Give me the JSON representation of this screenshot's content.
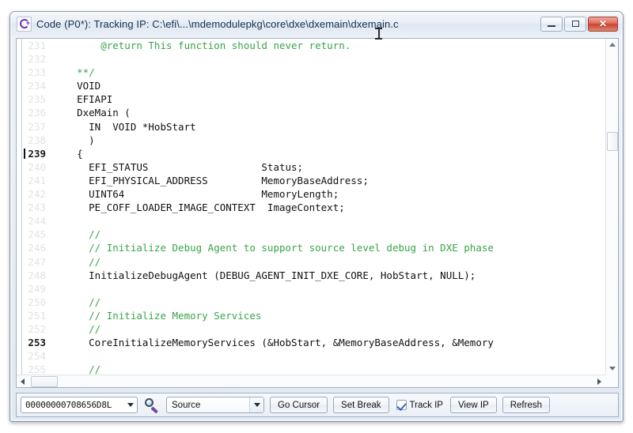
{
  "window": {
    "icon_name": "code-debugger-icon",
    "title": "Code (P0*): Tracking IP: C:\\efi\\...\\mdemodulepkg\\core\\dxe\\dxemain\\dxemain.c",
    "controls": {
      "minimize": "minimize-icon",
      "maximize": "maximize-icon",
      "close": "✕"
    }
  },
  "editor": {
    "current_line": "239",
    "breakpoint_line": "253",
    "lines": [
      {
        "num": "231",
        "text": "        @return This function should never return.",
        "style": "comment",
        "active": false,
        "caret": false
      },
      {
        "num": "232",
        "text": "",
        "style": "code",
        "active": false,
        "caret": false
      },
      {
        "num": "233",
        "text": "    **/",
        "style": "comment",
        "active": false,
        "caret": false
      },
      {
        "num": "234",
        "text": "    VOID",
        "style": "code",
        "active": false,
        "caret": false
      },
      {
        "num": "235",
        "text": "    EFIAPI",
        "style": "code",
        "active": false,
        "caret": false
      },
      {
        "num": "236",
        "text": "    DxeMain (",
        "style": "code",
        "active": false,
        "caret": false
      },
      {
        "num": "237",
        "text": "      IN  VOID *HobStart",
        "style": "code",
        "active": false,
        "caret": false
      },
      {
        "num": "238",
        "text": "      )",
        "style": "code",
        "active": false,
        "caret": false
      },
      {
        "num": "239",
        "text": "    {",
        "style": "code",
        "active": true,
        "caret": true
      },
      {
        "num": "240",
        "text": "      EFI_STATUS                   Status;",
        "style": "code",
        "active": false,
        "caret": false
      },
      {
        "num": "241",
        "text": "      EFI_PHYSICAL_ADDRESS         MemoryBaseAddress;",
        "style": "code",
        "active": false,
        "caret": false
      },
      {
        "num": "242",
        "text": "      UINT64                       MemoryLength;",
        "style": "code",
        "active": false,
        "caret": false
      },
      {
        "num": "243",
        "text": "      PE_COFF_LOADER_IMAGE_CONTEXT  ImageContext;",
        "style": "code",
        "active": false,
        "caret": false
      },
      {
        "num": "244",
        "text": "",
        "style": "code",
        "active": false,
        "caret": false
      },
      {
        "num": "245",
        "text": "      //",
        "style": "comment",
        "active": false,
        "caret": false
      },
      {
        "num": "246",
        "text": "      // Initialize Debug Agent to support source level debug in DXE phase",
        "style": "comment",
        "active": false,
        "caret": false
      },
      {
        "num": "247",
        "text": "      //",
        "style": "comment",
        "active": false,
        "caret": false
      },
      {
        "num": "248",
        "text": "      InitializeDebugAgent (DEBUG_AGENT_INIT_DXE_CORE, HobStart, NULL);",
        "style": "code",
        "active": false,
        "caret": false
      },
      {
        "num": "249",
        "text": "",
        "style": "code",
        "active": false,
        "caret": false
      },
      {
        "num": "250",
        "text": "      //",
        "style": "comment",
        "active": false,
        "caret": false
      },
      {
        "num": "251",
        "text": "      // Initialize Memory Services",
        "style": "comment",
        "active": false,
        "caret": false
      },
      {
        "num": "252",
        "text": "      //",
        "style": "comment",
        "active": false,
        "caret": false
      },
      {
        "num": "253",
        "text": "      CoreInitializeMemoryServices (&HobStart, &MemoryBaseAddress, &Memory",
        "style": "code",
        "active": true,
        "caret": false
      },
      {
        "num": "254",
        "text": "",
        "style": "code",
        "active": false,
        "caret": false
      },
      {
        "num": "255",
        "text": "      //",
        "style": "comment",
        "active": false,
        "caret": false
      }
    ]
  },
  "toolbar": {
    "address_value": "00000000708656D8L",
    "magnifier_icon": "magnifier-icon",
    "source_select_value": "Source",
    "go_cursor_label": "Go Cursor",
    "set_break_label": "Set Break",
    "track_ip_label": "Track IP",
    "track_ip_checked": true,
    "view_ip_label": "View IP",
    "refresh_label": "Refresh"
  },
  "colors": {
    "comment_green": "#3aa34a",
    "code_black": "#111111",
    "line_number_grey": "#dfe2e6",
    "accent_purple": "#6b2fb5",
    "close_red": "#c9432f"
  }
}
